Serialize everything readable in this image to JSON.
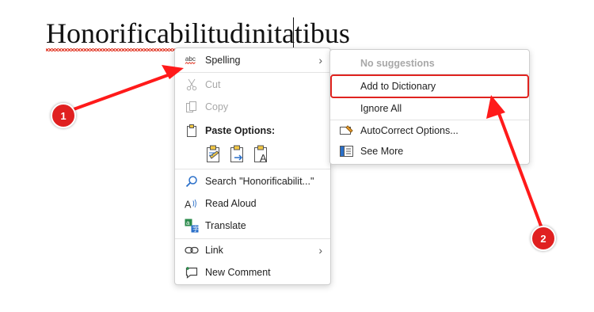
{
  "document": {
    "word": "Honorificabilitudinitatibus"
  },
  "context_menu": {
    "items": [
      {
        "label": "Spelling",
        "icon": "spelling-abc-icon",
        "submenu": true
      },
      {
        "label": "Cut",
        "icon": "scissors-icon",
        "disabled": true
      },
      {
        "label": "Copy",
        "icon": "copy-icon",
        "disabled": true
      },
      {
        "label": "Paste Options:",
        "icon": "clipboard-icon"
      },
      {
        "label": "Search \"Honorificabilit...\"",
        "icon": "search-icon"
      },
      {
        "label": "Read Aloud",
        "icon": "read-aloud-icon"
      },
      {
        "label": "Translate",
        "icon": "translate-icon"
      },
      {
        "label": "Link",
        "icon": "link-icon",
        "submenu": true
      },
      {
        "label": "New Comment",
        "icon": "comment-icon"
      }
    ]
  },
  "spelling_submenu": {
    "items": [
      {
        "label": "No suggestions",
        "disabled": true
      },
      {
        "label": "Add to Dictionary"
      },
      {
        "label": "Ignore All"
      },
      {
        "label": "AutoCorrect Options...",
        "icon": "autocorrect-icon"
      },
      {
        "label": "See More",
        "icon": "see-more-icon"
      }
    ]
  },
  "annotations": {
    "marker_1": "1",
    "marker_2": "2"
  },
  "colors": {
    "accent": "#e02020",
    "squiggle": "#e0301e"
  }
}
